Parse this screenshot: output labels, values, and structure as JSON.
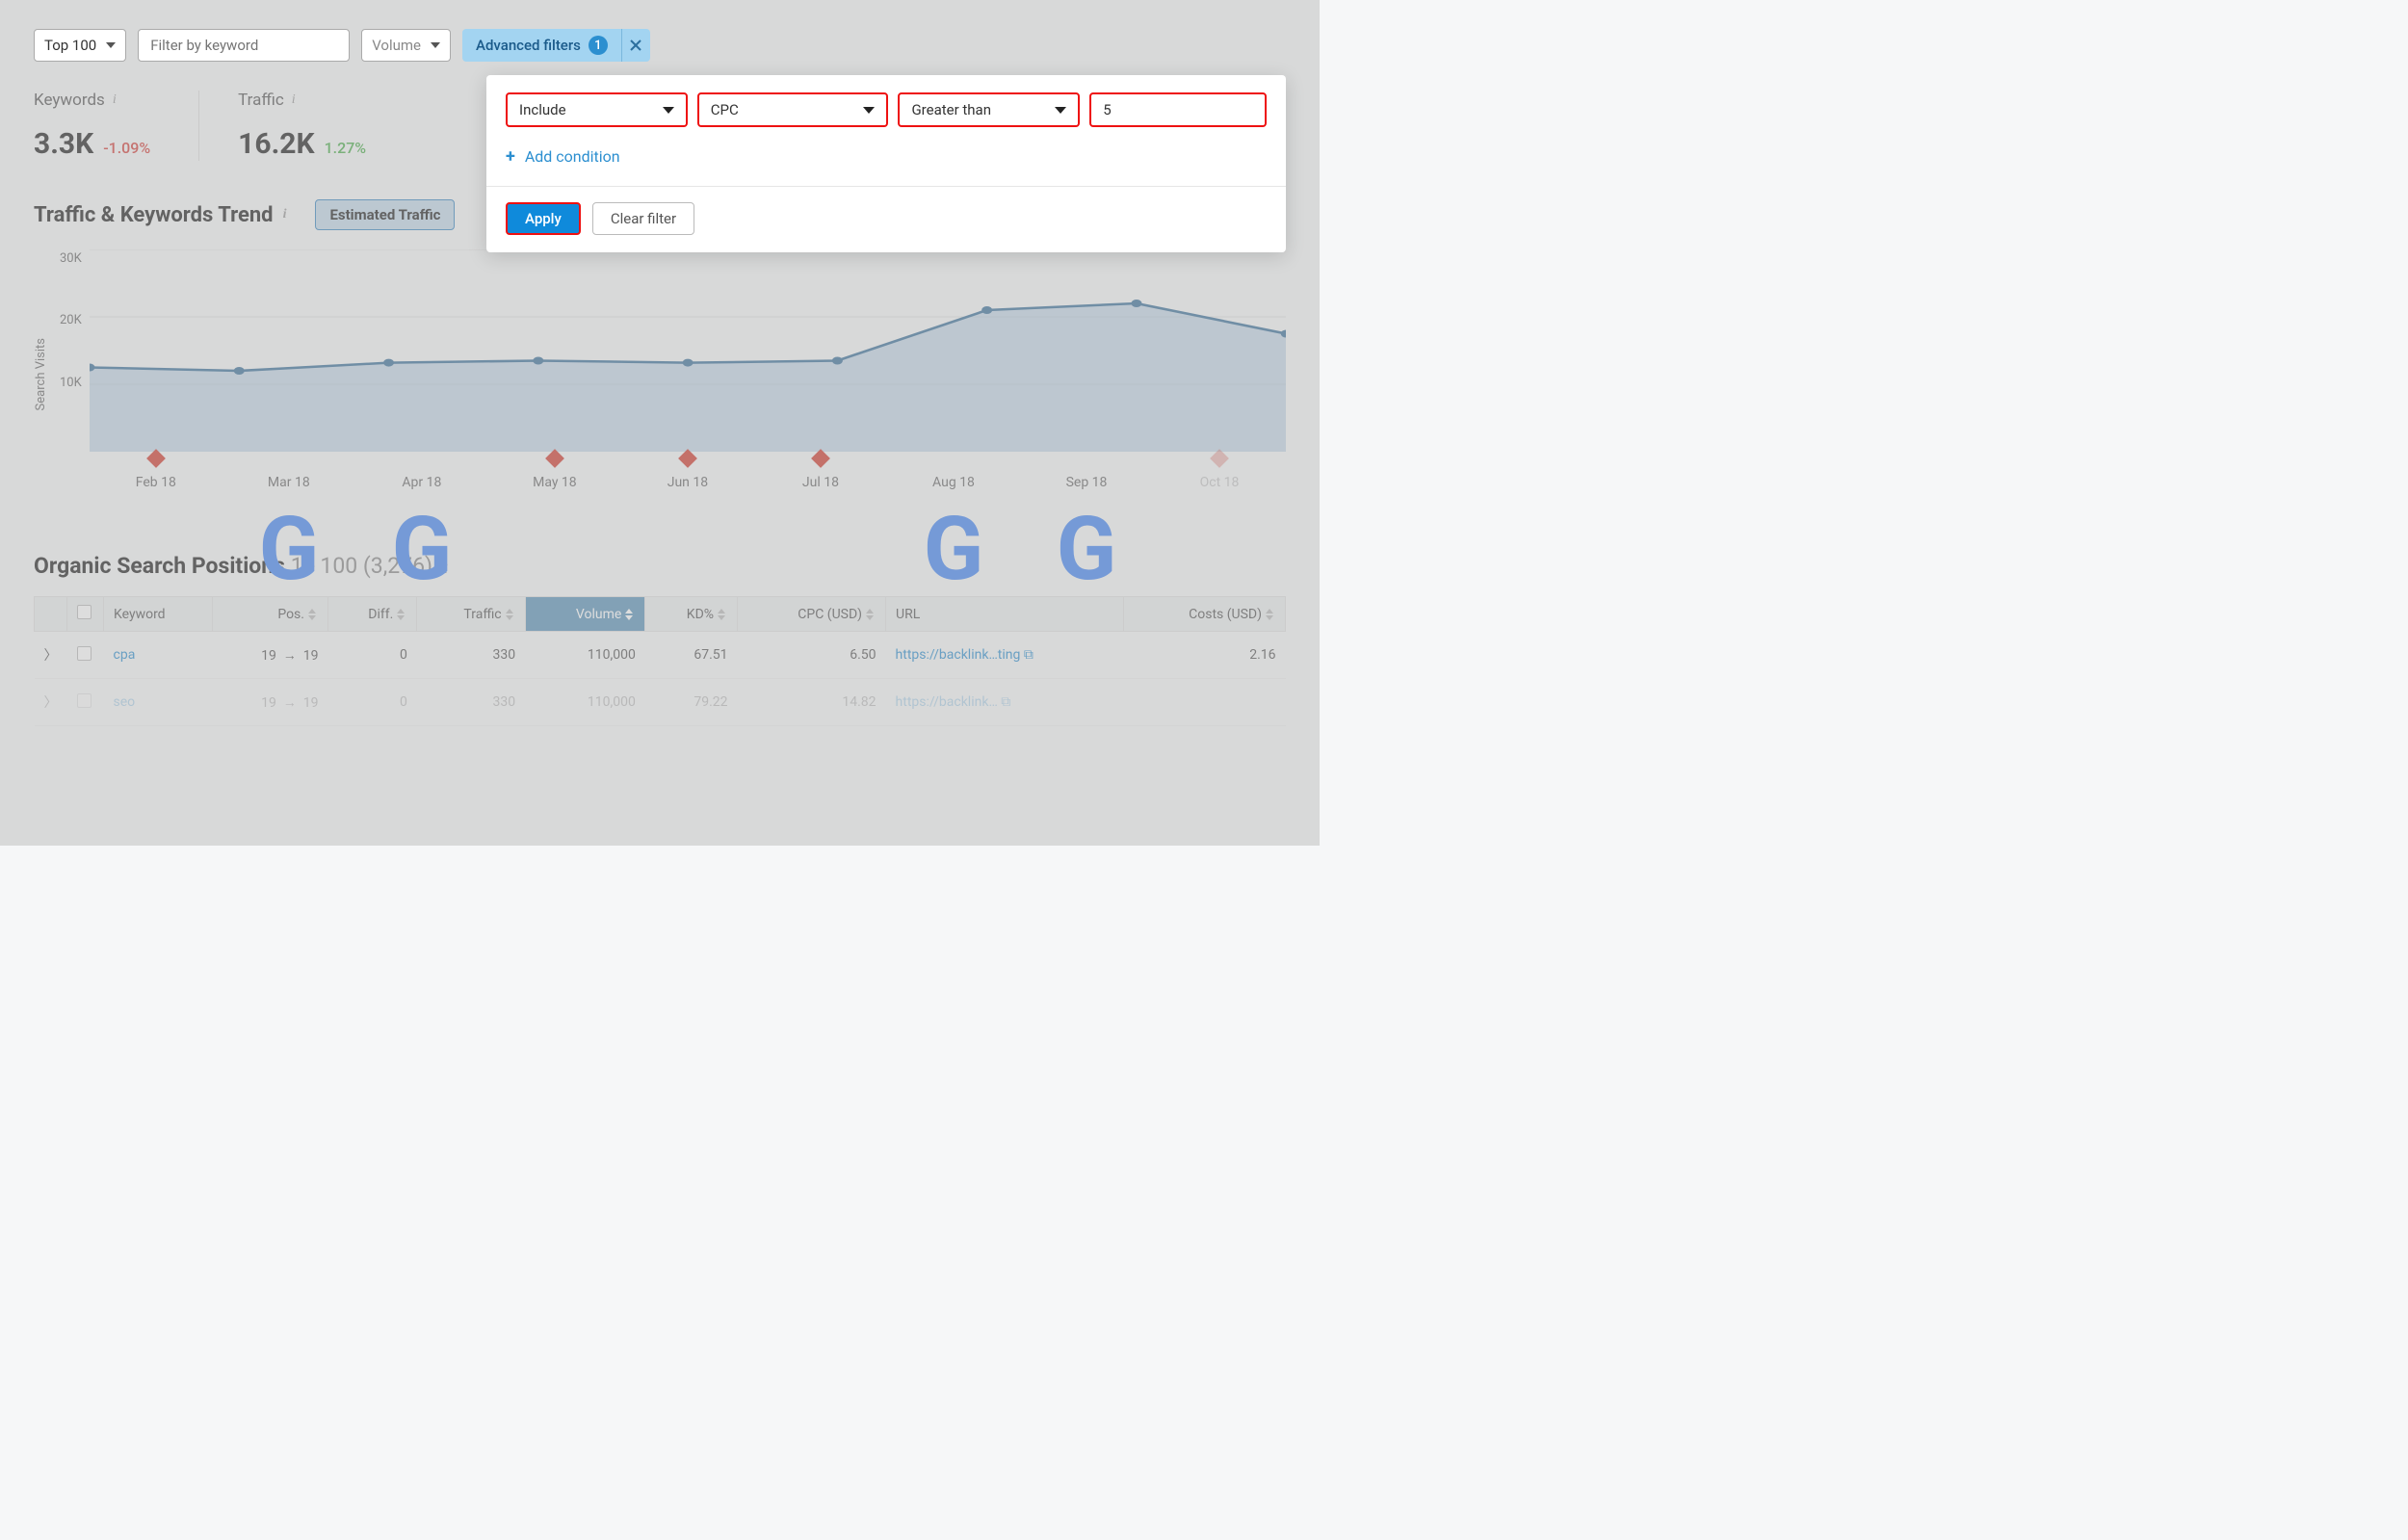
{
  "toolbar": {
    "top_select": "Top 100",
    "filter_placeholder": "Filter by keyword",
    "volume_label": "Volume",
    "advanced_label": "Advanced filters",
    "advanced_count": "1"
  },
  "stats": {
    "keywords_label": "Keywords",
    "keywords_value": "3.3K",
    "keywords_delta": "-1.09%",
    "traffic_label": "Traffic",
    "traffic_value": "16.2K",
    "traffic_delta": "1.27%"
  },
  "trend": {
    "title": "Traffic & Keywords Trend",
    "tab": "Estimated Traffic",
    "ylabel": "Search Visits",
    "yticks": [
      "30K",
      "20K",
      "10K"
    ],
    "xticks": [
      "Feb 18",
      "Mar 18",
      "Apr 18",
      "May 18",
      "Jun 18",
      "Jul 18",
      "Aug 18",
      "Sep 18",
      "Oct 18"
    ],
    "markers": [
      "diamond",
      "g",
      "g",
      "diamond",
      "diamond",
      "diamond",
      "g",
      "g",
      "diamond"
    ]
  },
  "chart_data": {
    "type": "area",
    "title": "Traffic & Keywords Trend",
    "xlabel": "",
    "ylabel": "Search Visits",
    "ylim": [
      0,
      30000
    ],
    "categories": [
      "Feb 18",
      "Mar 18",
      "Apr 18",
      "May 18",
      "Jun 18",
      "Jul 18",
      "Aug 18",
      "Sep 18",
      "Oct 18"
    ],
    "series": [
      {
        "name": "Estimated Traffic",
        "values": [
          12500,
          12000,
          13200,
          13500,
          13200,
          13500,
          21000,
          22000,
          17500
        ]
      }
    ]
  },
  "positions": {
    "title_a": "Organic Search Positions",
    "title_b": "1 - 100 (3,276)",
    "columns": {
      "keyword": "Keyword",
      "pos": "Pos.",
      "diff": "Diff.",
      "traffic": "Traffic",
      "volume": "Volume",
      "kd": "KD%",
      "cpc": "CPC (USD)",
      "url": "URL",
      "costs": "Costs (USD)"
    },
    "rows": [
      {
        "keyword": "cpa",
        "pos_from": "19",
        "pos_to": "19",
        "diff": "0",
        "traffic": "330",
        "volume": "110,000",
        "kd": "67.51",
        "cpc": "6.50",
        "url": "https://backlink…ting",
        "costs": "2.16"
      },
      {
        "keyword": "seo",
        "pos_from": "19",
        "pos_to": "19",
        "diff": "0",
        "traffic": "330",
        "volume": "110,000",
        "kd": "79.22",
        "cpc": "14.82",
        "url": "https://backlink…",
        "costs": ""
      }
    ]
  },
  "popover": {
    "cond_include": "Include",
    "cond_metric": "CPC",
    "cond_op": "Greater than",
    "cond_value": "5",
    "add_condition": "Add condition",
    "apply": "Apply",
    "clear": "Clear filter"
  }
}
